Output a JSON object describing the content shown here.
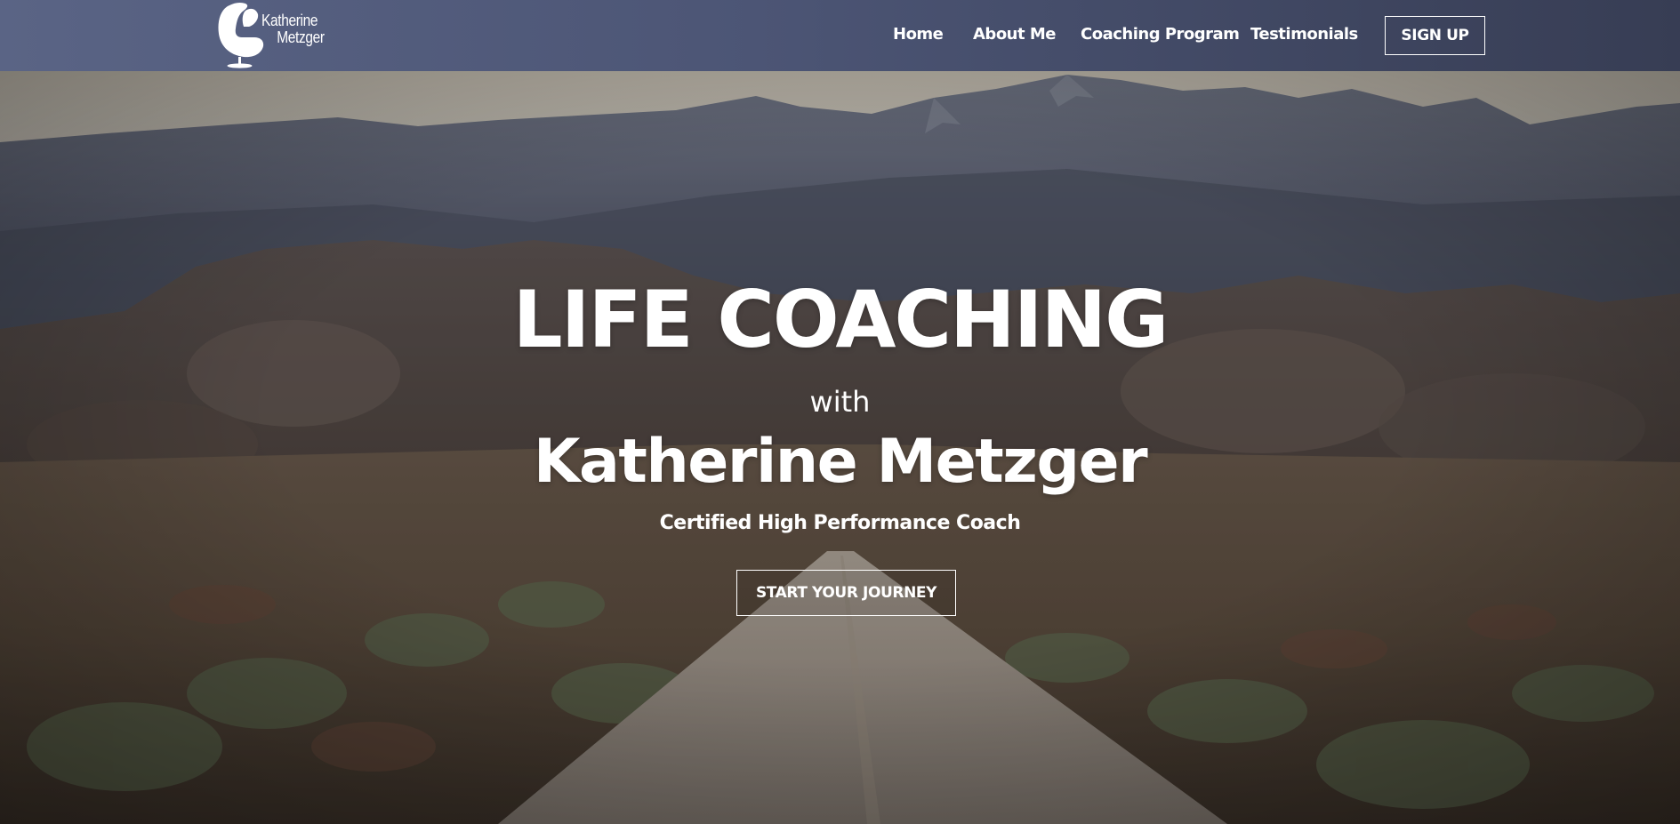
{
  "brand": {
    "logo_line1": "Katherine",
    "logo_line2": "Metzger",
    "logo_icon": "egg-chair-icon"
  },
  "nav": {
    "items": [
      {
        "label": "Home"
      },
      {
        "label": "About Me"
      },
      {
        "label": "Coaching Program"
      },
      {
        "label": "Testimonials"
      }
    ],
    "signup_label": "SIGN UP"
  },
  "hero": {
    "title": "LIFE COACHING",
    "with": "with",
    "name": "Katherine Metzger",
    "subtitle": "Certified High Performance Coach",
    "cta_label": "START YOUR JOURNEY",
    "background": "desert-road-mountains-photo"
  },
  "colors": {
    "header_start": "#5a6485",
    "header_end": "#373d54",
    "text": "#ffffff"
  }
}
